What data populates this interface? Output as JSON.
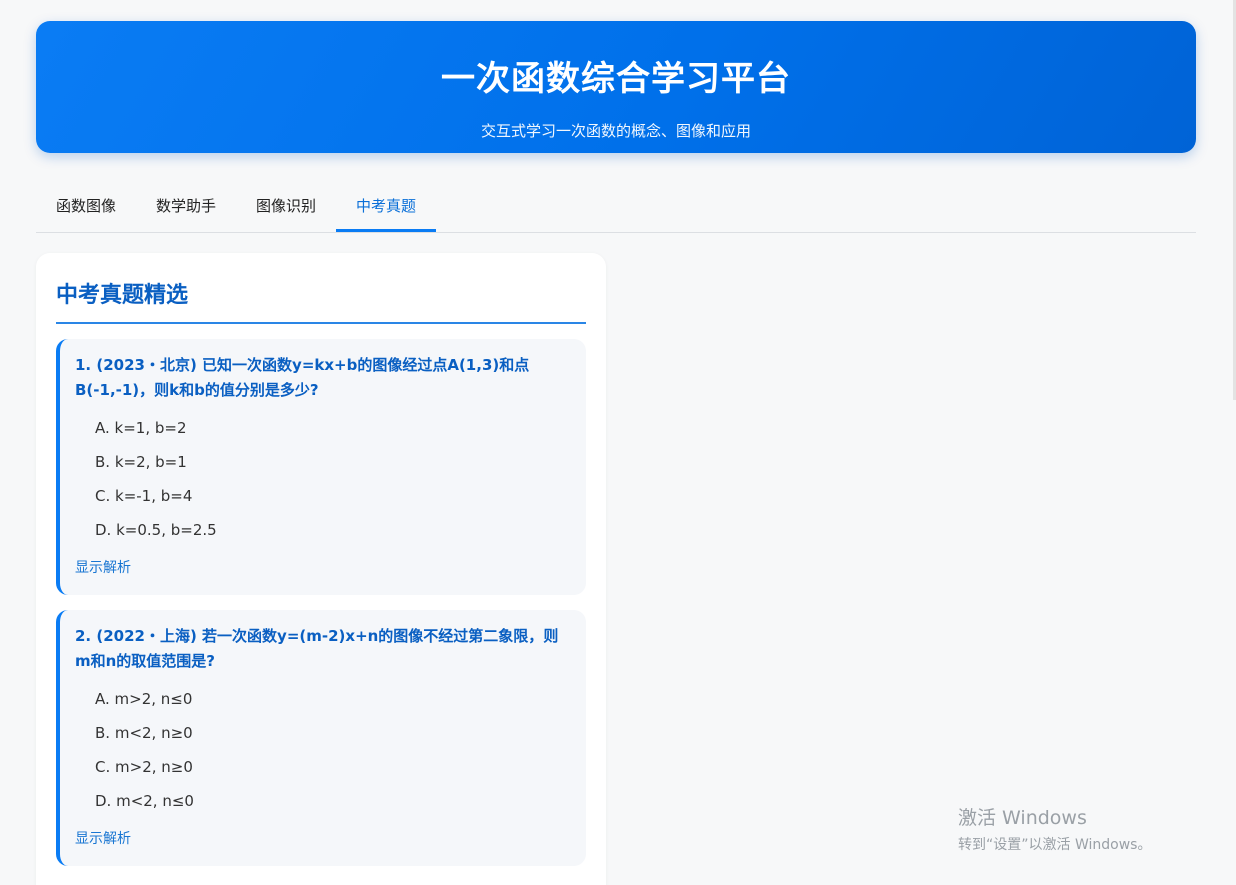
{
  "header": {
    "title": "一次函数综合学习平台",
    "subtitle": "交互式学习一次函数的概念、图像和应用"
  },
  "tabs": [
    {
      "label": "函数图像"
    },
    {
      "label": "数学助手"
    },
    {
      "label": "图像识别"
    },
    {
      "label": "中考真题"
    }
  ],
  "active_tab": 3,
  "panel": {
    "title": "中考真题精选",
    "questions": [
      {
        "text": "1. (2023・北京) 已知一次函数y=kx+b的图像经过点A(1,3)和点B(-1,-1)，则k和b的值分别是多少?",
        "options": [
          "A. k=1, b=2",
          "B. k=2, b=1",
          "C. k=-1, b=4",
          "D. k=0.5, b=2.5"
        ],
        "toggle": "显示解析"
      },
      {
        "text": "2. (2022・上海) 若一次函数y=(m-2)x+n的图像不经过第二象限，则m和n的取值范围是?",
        "options": [
          "A. m>2, n≤0",
          "B. m<2, n≥0",
          "C. m>2, n≥0",
          "D. m<2, n≤0"
        ],
        "toggle": "显示解析"
      }
    ]
  },
  "watermark": {
    "line1": "激活 Windows",
    "line2": "转到“设置”以激活 Windows。"
  },
  "colors": {
    "accent": "#0a7cf4",
    "title_blue": "#0a5fc2"
  }
}
